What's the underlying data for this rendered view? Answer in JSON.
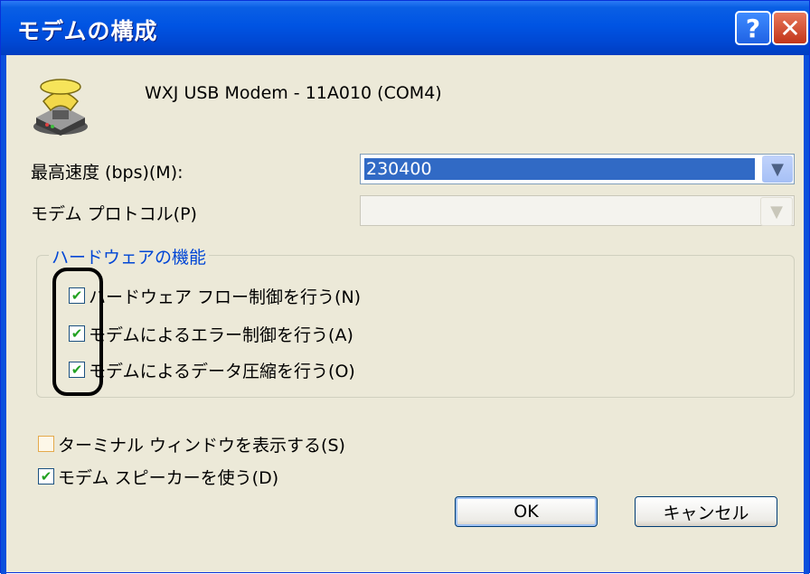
{
  "window": {
    "title": "モデムの構成"
  },
  "titlebar_buttons": {
    "help": "?",
    "close": "✕"
  },
  "modem_name": "WXJ USB Modem - 11A010 (COM4)",
  "max_speed": {
    "label": "最高速度 (bps)(M):",
    "value": "230400"
  },
  "protocol": {
    "label": "モデム プロトコル(P)",
    "value": ""
  },
  "hardware_group": {
    "title": "ハードウェアの機能",
    "items": [
      {
        "label": "ハードウェア フロー制御を行う(N)",
        "checked": true
      },
      {
        "label": "モデムによるエラー制御を行う(A)",
        "checked": true
      },
      {
        "label": "モデムによるデータ圧縮を行う(O)",
        "checked": true
      }
    ]
  },
  "terminal_window": {
    "label": "ターミナル ウィンドウを表示する(S)",
    "checked": false
  },
  "speaker": {
    "label": "モデム スピーカーを使う(D)",
    "checked": true
  },
  "buttons": {
    "ok": "OK",
    "cancel": "キャンセル"
  },
  "check_glyph": "✔"
}
